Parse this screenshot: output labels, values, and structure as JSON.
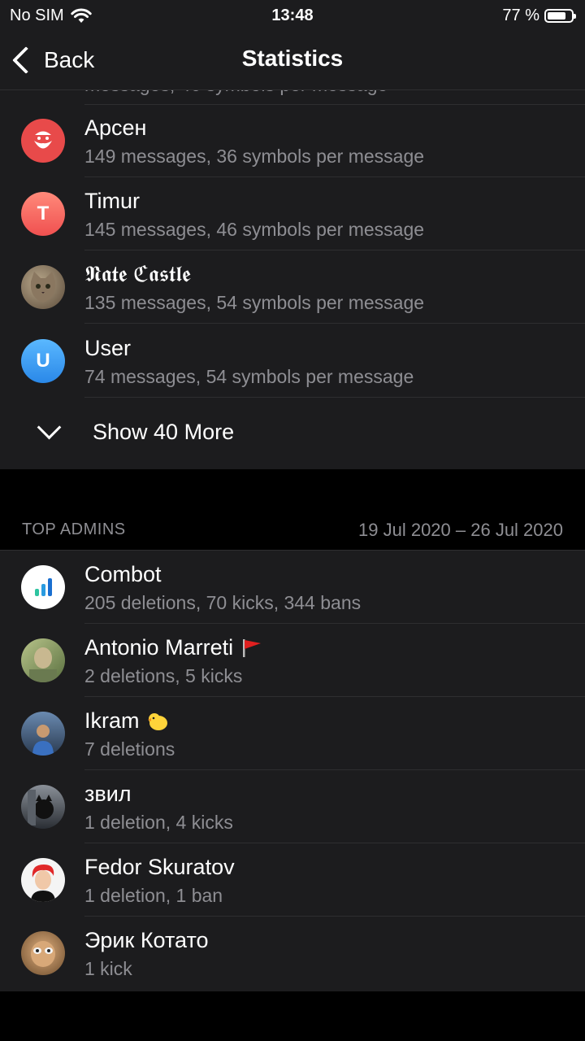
{
  "status_bar": {
    "carrier": "No SIM",
    "time": "13:48",
    "battery_text": "77 %",
    "battery_level": 0.77
  },
  "nav": {
    "back_label": "Back",
    "title": "Statistics"
  },
  "top_members": {
    "rows": [
      {
        "name": "Арсен",
        "sub": "149 messages, 36 symbols per message",
        "avatar_color": "#e84a4a",
        "avatar_icon": "santa-icon"
      },
      {
        "name": "Timur",
        "sub": "145 messages, 46 symbols per message",
        "avatar_color": "#f46a6a",
        "avatar_letter": "T"
      },
      {
        "name": "𝕹𝖆𝖙𝖊 ℭ𝖆𝖘𝖙𝖑𝖊",
        "sub": "135 messages, 54 symbols per message",
        "avatar_color": "#7a6a55",
        "avatar_icon": "cat-photo-icon"
      },
      {
        "name": "User",
        "sub": "74 messages, 54 symbols per message",
        "avatar_color": "#3e9cf0",
        "avatar_letter": "U"
      }
    ],
    "show_more_label": "Show 40 More"
  },
  "top_admins": {
    "header": "TOP ADMINS",
    "date_range": "19 Jul 2020 – 26 Jul 2020",
    "rows": [
      {
        "name": "Combot",
        "sub": "205 deletions, 70 kicks, 344 bans",
        "avatar_color": "#ffffff",
        "avatar_icon": "bar-chart-icon"
      },
      {
        "name": "Antonio Marreti",
        "sub": "2 deletions, 5 kicks",
        "avatar_color": "#8aa36b",
        "avatar_icon": "photo-avatar-icon",
        "badge": "red-flag-icon"
      },
      {
        "name": "Ikram",
        "sub": "7 deletions",
        "avatar_color": "#3a5a7a",
        "avatar_icon": "photo-avatar-icon",
        "badge": "chick-emoji-icon"
      },
      {
        "name": "звил",
        "sub": "1 deletion, 4 kicks",
        "avatar_color": "#4a5058",
        "avatar_icon": "photo-avatar-icon"
      },
      {
        "name": "Fedor Skuratov",
        "sub": "1 deletion, 1 ban",
        "avatar_color": "#f2f2f2",
        "avatar_icon": "red-hair-avatar-icon"
      },
      {
        "name": "Эрик Котато",
        "sub": "1 kick",
        "avatar_color": "#b07a4a",
        "avatar_icon": "photo-avatar-icon"
      }
    ]
  }
}
